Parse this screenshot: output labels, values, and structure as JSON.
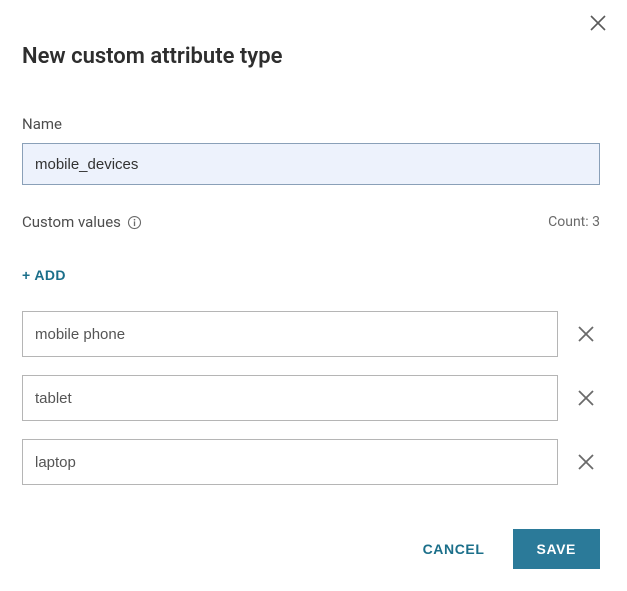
{
  "header": {
    "title": "New custom attribute type"
  },
  "name": {
    "label": "Name",
    "value": "mobile_devices"
  },
  "custom_values": {
    "label": "Custom values",
    "count_label": "Count: 3",
    "add_label": "+ ADD",
    "items": [
      {
        "value": "mobile phone"
      },
      {
        "value": "tablet"
      },
      {
        "value": "laptop"
      }
    ]
  },
  "footer": {
    "cancel_label": "CANCEL",
    "save_label": "SAVE"
  }
}
